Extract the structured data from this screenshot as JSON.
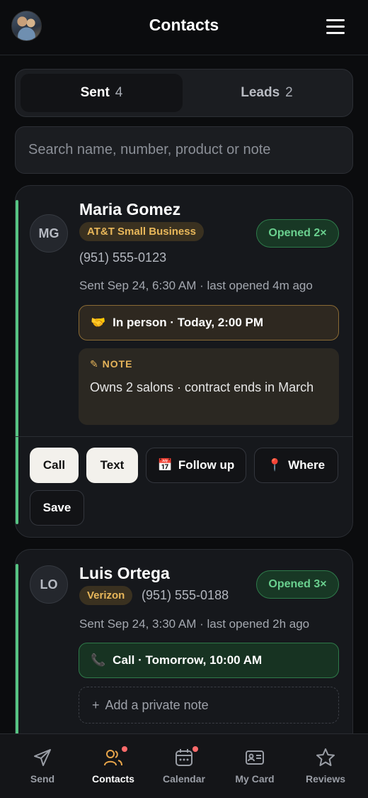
{
  "header": {
    "title": "Contacts"
  },
  "tabs": [
    {
      "label": "Sent",
      "count": "4"
    },
    {
      "label": "Leads",
      "count": "2"
    }
  ],
  "search": {
    "placeholder": "Search name, number, product or note"
  },
  "contacts": [
    {
      "initials": "MG",
      "name": "Maria Gomez",
      "carrier": "AT&T Small Business",
      "opened": "Opened 2×",
      "phone": "(951) 555-0123",
      "meta": "Sent Sep 24, 6:30 AM · last opened 4m ago",
      "appointment": {
        "icon": "🤝",
        "text": "In person · Today, 2:00 PM"
      },
      "note": {
        "heading": "✎ NOTE",
        "text": "Owns 2 salons · contract ends in March"
      },
      "actions": {
        "call": "Call",
        "text": "Text",
        "follow_up_icon": "📅",
        "follow_up": "Follow up",
        "where_icon": "📍",
        "where": "Where",
        "save": "Save"
      }
    },
    {
      "initials": "LO",
      "name": "Luis Ortega",
      "carrier": "Verizon",
      "opened": "Opened 3×",
      "phone": "(951) 555-0188",
      "meta": "Sent Sep 24, 3:30 AM · last opened 2h ago",
      "appointment": {
        "icon": "📞",
        "text": "Call · Tomorrow, 10:00 AM"
      },
      "add_note": {
        "icon": "+",
        "text": "Add a private note"
      }
    }
  ],
  "nav": [
    {
      "label": "Send",
      "icon": "send-icon"
    },
    {
      "label": "Contacts",
      "icon": "contacts-icon",
      "active": true,
      "badge": true
    },
    {
      "label": "Calendar",
      "icon": "calendar-icon",
      "badge": true
    },
    {
      "label": "My Card",
      "icon": "card-icon"
    },
    {
      "label": "Reviews",
      "icon": "star-icon"
    }
  ],
  "colors": {
    "accent_green": "#57c483",
    "tag_gold": "#e8b75a",
    "badge_red": "#ff6b6b"
  }
}
